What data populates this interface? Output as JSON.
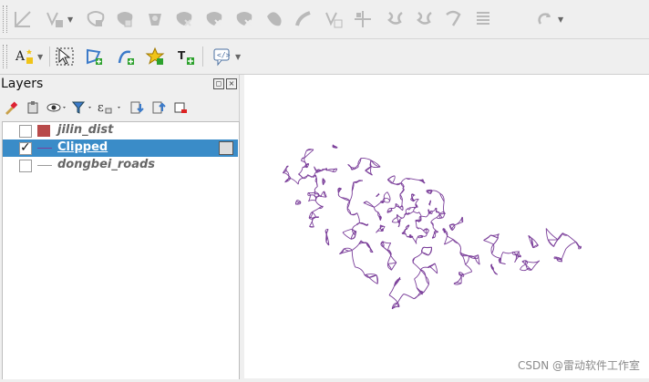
{
  "panel": {
    "title": "Layers",
    "float_glyph": "◻",
    "close_glyph": "×"
  },
  "layers": [
    {
      "name": "jilin_dist",
      "checked": false,
      "selected": false,
      "symbol": "polygon",
      "color": "#b84a4a"
    },
    {
      "name": "Clipped",
      "checked": true,
      "selected": true,
      "symbol": "line",
      "color": "#7b3f9a"
    },
    {
      "name": "dongbei_roads",
      "checked": false,
      "selected": false,
      "symbol": "line",
      "color": "#9a9a9a"
    }
  ],
  "toolbar1_icons": [
    "digitize-icon",
    "vertex-tool-icon",
    "add-ring-icon",
    "add-part-icon",
    "fill-ring-icon",
    "delete-ring-icon",
    "delete-part-icon",
    "reshape-icon",
    "offset-curve-icon",
    "split-features-icon",
    "split-parts-icon",
    "merge-selected-icon",
    "merge-attributes-icon",
    "rotate-point-icon",
    "simplify-icon",
    "vertex-editor-icon",
    "undo-redo-icon"
  ],
  "toolbar2_icons": [
    "label-tool-icon",
    "select-tool-icon",
    "add-polygon-icon",
    "add-line-icon",
    "favorite-add-icon",
    "text-annotation-icon",
    "html-annotation-icon"
  ],
  "map": {
    "line_color": "#7b3f9a",
    "background": "#ffffff"
  },
  "watermark": "CSDN @雷动软件工作室"
}
